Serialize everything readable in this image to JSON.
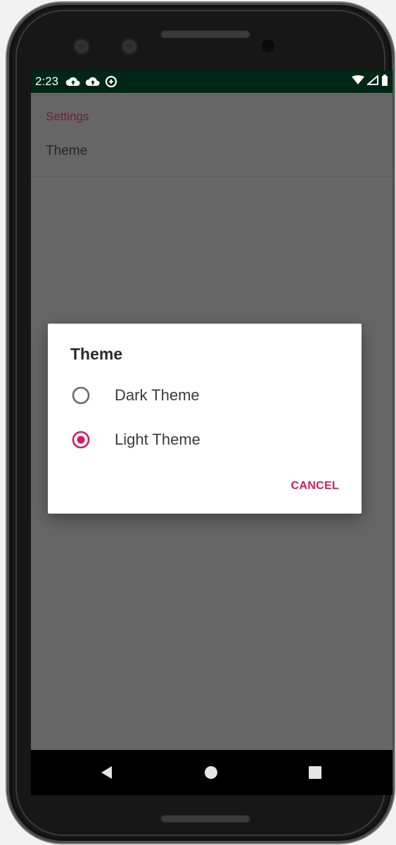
{
  "status_bar": {
    "time": "2:23",
    "left_icons": [
      "cloud-upload-icon",
      "cloud-upload-icon",
      "data-saver-icon"
    ],
    "right_icons": [
      "wifi-icon",
      "signal-icon",
      "battery-icon"
    ],
    "background_color": "#002618"
  },
  "settings": {
    "section_header": "Settings",
    "preference_title": "Theme"
  },
  "dialog": {
    "title": "Theme",
    "options": [
      {
        "label": "Dark Theme",
        "selected": false
      },
      {
        "label": "Light Theme",
        "selected": true
      }
    ],
    "cancel_label": "CANCEL",
    "accent_color": "#d81b60"
  },
  "nav_bar": {
    "buttons": [
      "back-icon",
      "home-icon",
      "recents-icon"
    ]
  },
  "colors": {
    "scrim_screen": "#666666",
    "header_text": "#6e1f3d",
    "accent": "#d81b60"
  }
}
